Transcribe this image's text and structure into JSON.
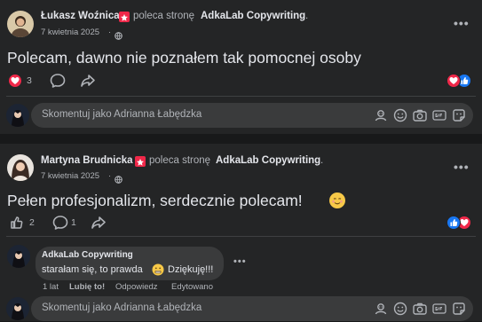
{
  "post1": {
    "author": "Łukasz Woźnica",
    "action": "poleca stronę",
    "page": "AdkaLab Copywriting",
    "punct": ".",
    "date": "7 kwietnia 2025",
    "sep": "·",
    "more": "•••",
    "text": "Polecam, dawno nie poznałem tak pomocnej osoby",
    "likes": "3",
    "comment_placeholder": "Skomentuj jako Adrianna Łabędzka"
  },
  "post2": {
    "author": "Martyna Brudnicka",
    "action": "poleca stronę",
    "page": "AdkaLab Copywriting",
    "punct": ".",
    "date": "7 kwietnia 2025",
    "sep": "·",
    "more": "•••",
    "text": "Pełen profesjonalizm, serdecznie polecam!",
    "likes": "2",
    "comments": "1",
    "comment_placeholder": "Skomentuj jako Adrianna Łabędzka",
    "reply": {
      "author": "AdkaLab Copywriting",
      "text_before": "starałam się, to prawda",
      "text_after": "Dziękuję!!!",
      "more": "•••",
      "time": "1 lat",
      "like": "Lubię to!",
      "reply": "Odpowiedz",
      "edited": "Edytowano"
    }
  },
  "icons": {
    "recommend": "recommend-star-icon",
    "globe": "globe-icon",
    "like": "like-icon",
    "love": "love-icon",
    "comment": "comment-icon",
    "share": "share-icon",
    "emoji": "emoji-icon",
    "sticker": "sticker-icon",
    "camera": "camera-icon",
    "gif": "gif-icon",
    "avatar": "avatar-icon"
  },
  "colors": {
    "background": "#18191a",
    "card": "#242526",
    "input": "#3a3b3c",
    "text": "#e4e6eb",
    "secondary": "#b0b3b8",
    "like_blue": "#1877f2",
    "love_red": "#f02849"
  }
}
